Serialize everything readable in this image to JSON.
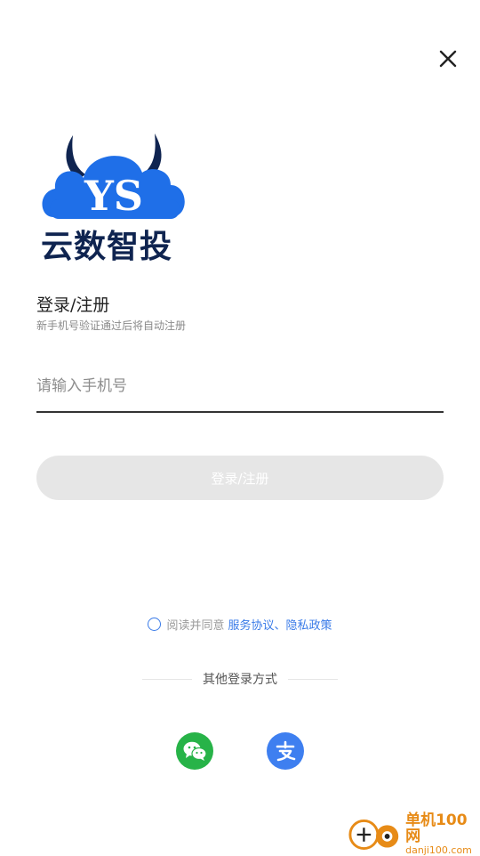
{
  "header": {
    "close_icon": "close-icon"
  },
  "logo": {
    "mark_text": "YS",
    "name": "云数智投",
    "brand_color": "#1f6fe8",
    "dark_color": "#0f2450"
  },
  "login": {
    "title": "登录/注册",
    "subtitle": "新手机号验证通过后将自动注册",
    "phone_placeholder": "请输入手机号",
    "phone_value": "",
    "submit_label": "登录/注册"
  },
  "agreement": {
    "checked": false,
    "prefix": "阅读并同意",
    "service_link": "服务协议",
    "separator": "、",
    "privacy_link": "隐私政策"
  },
  "other_login": {
    "label": "其他登录方式",
    "methods": [
      {
        "icon": "wechat-icon",
        "color": "#27b348"
      },
      {
        "icon": "alipay-icon",
        "color": "#3e7ff0"
      }
    ]
  },
  "watermark": {
    "cn": "单机100网",
    "en": "danji100.com",
    "color": "#e78b17"
  },
  "colors": {
    "accent": "#3a7be8",
    "button_disabled": "#e6e6e6"
  }
}
